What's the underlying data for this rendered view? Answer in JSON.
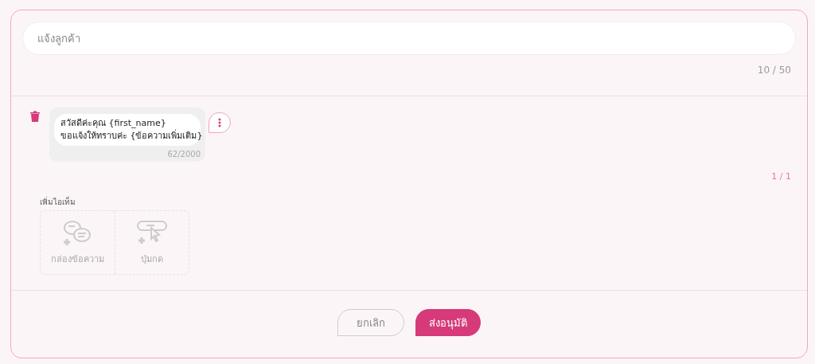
{
  "title_field": {
    "value": "แจ้งลูกค้า",
    "counter": "10 / 50"
  },
  "messages": [
    {
      "lines": [
        "สวัสดีค่ะคุณ {first_name}",
        "ขอแจ้งให้ทราบค่ะ {ข้อความเพิ่มเติม}"
      ],
      "counter": "62/2000"
    }
  ],
  "page_counter": "1 / 1",
  "add_items": {
    "label": "เพิ่มไอเท็ม",
    "items": [
      {
        "kind": "message-box",
        "label": "กล่องข้อความ",
        "disabled": true
      },
      {
        "kind": "button",
        "label": "ปุ่มกด",
        "disabled": true
      }
    ]
  },
  "buttons": [
    {
      "kind": "secondary",
      "label": "ยกเลิก"
    },
    {
      "kind": "primary",
      "label": "ส่งอนุมัติ"
    }
  ]
}
